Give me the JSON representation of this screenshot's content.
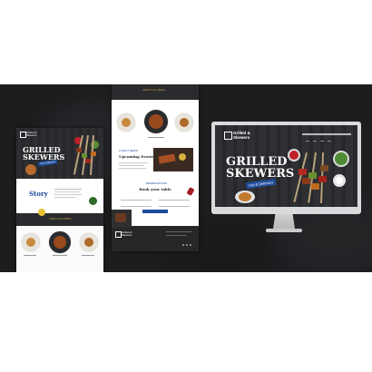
{
  "brand": {
    "name_line1": "Grilled &",
    "name_line2": "Skewers"
  },
  "hero": {
    "title_line1": "GRILLED",
    "title_line2": "SKEWERS",
    "script": "Hot & Delicious"
  },
  "left_page": {
    "story_heading": "Story",
    "menu_band_label": "VIEW FULL MENU"
  },
  "center_page": {
    "top_band_label": "VIEW FULL MENU",
    "events_label": "LATEST NEWS",
    "events_heading": "Upcoming Events",
    "book_label": "RESERVATIONS",
    "book_heading": "Book your table"
  },
  "colors": {
    "background": "#1c1d1f",
    "accent_blue": "#1f4c9a",
    "accent_gold": "#c9a34a"
  }
}
